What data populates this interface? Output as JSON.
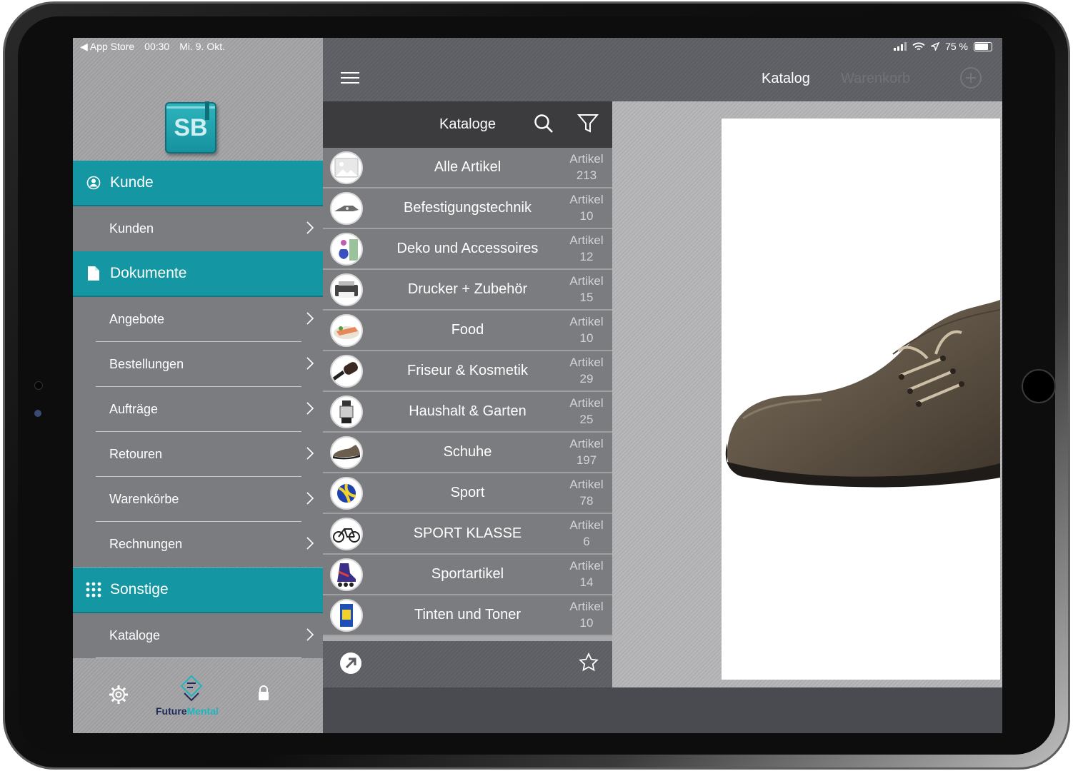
{
  "status_bar": {
    "back_app": "◀ App Store",
    "time": "00:30",
    "date": "Mi. 9. Okt.",
    "battery": "75 %",
    "battery_level": 0.75
  },
  "sidebar": {
    "logo_text": "SB",
    "sections": [
      {
        "label": "Kunde",
        "icon": "user-circle-icon",
        "items": [
          {
            "label": "Kunden"
          }
        ]
      },
      {
        "label": "Dokumente",
        "icon": "document-icon",
        "items": [
          {
            "label": "Angebote"
          },
          {
            "label": "Bestellungen"
          },
          {
            "label": "Aufträge"
          },
          {
            "label": "Retouren"
          },
          {
            "label": "Warenkörbe"
          },
          {
            "label": "Rechnungen"
          }
        ]
      },
      {
        "label": "Sonstige",
        "icon": "grid-icon",
        "items": [
          {
            "label": "Kataloge"
          }
        ]
      }
    ],
    "footer": {
      "brand_part1": "Future",
      "brand_part2": "Mental"
    }
  },
  "topbar": {
    "tab_active": "Katalog",
    "tab_inactive": "Warenkorb"
  },
  "catalog_list": {
    "title": "Kataloge",
    "count_label": "Artikel",
    "items": [
      {
        "name": "Alle Artikel",
        "count": "213"
      },
      {
        "name": "Befestigungstechnik",
        "count": "10"
      },
      {
        "name": "Deko und Accessoires",
        "count": "12"
      },
      {
        "name": "Drucker + Zubehör",
        "count": "15"
      },
      {
        "name": "Food",
        "count": "10"
      },
      {
        "name": "Friseur & Kosmetik",
        "count": "29"
      },
      {
        "name": "Haushalt & Garten",
        "count": "25"
      },
      {
        "name": "Schuhe",
        "count": "197"
      },
      {
        "name": "Sport",
        "count": "78"
      },
      {
        "name": "SPORT KLASSE",
        "count": "6"
      },
      {
        "name": "Sportartikel",
        "count": "14"
      },
      {
        "name": "Tinten und Toner",
        "count": "10"
      }
    ]
  },
  "colors": {
    "accent": "#1597a3",
    "sidebar_item": "#7b7c80",
    "header_dark": "#3c3c3e"
  }
}
